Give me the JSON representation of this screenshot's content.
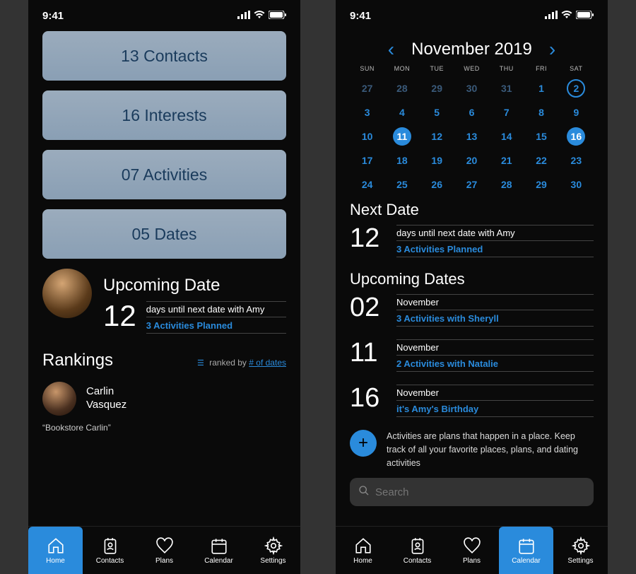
{
  "status": {
    "time": "9:41"
  },
  "home": {
    "cards": {
      "contacts": "13 Contacts",
      "interests": "16 Interests",
      "activities": "07 Activities",
      "dates": "05 Dates"
    },
    "upcoming": {
      "title": "Upcoming Date",
      "days": "12",
      "line1": "days until next date with Amy",
      "line2": "3 Activities Planned"
    },
    "rankings": {
      "title": "Rankings",
      "by_label": "ranked by",
      "by_metric": "# of dates",
      "person_first": "Carlin",
      "person_last": "Vasquez",
      "quote": "“Bookstore Carlin”"
    }
  },
  "calendar": {
    "month": "November 2019",
    "dow": [
      "SUN",
      "MON",
      "TUE",
      "WED",
      "THU",
      "FRI",
      "SAT"
    ],
    "days": [
      {
        "n": "27",
        "dim": true
      },
      {
        "n": "28",
        "dim": true
      },
      {
        "n": "29",
        "dim": true
      },
      {
        "n": "30",
        "dim": true
      },
      {
        "n": "31",
        "dim": true
      },
      {
        "n": "1"
      },
      {
        "n": "2",
        "ring": true
      },
      {
        "n": "3"
      },
      {
        "n": "4"
      },
      {
        "n": "5"
      },
      {
        "n": "6"
      },
      {
        "n": "7"
      },
      {
        "n": "8"
      },
      {
        "n": "9"
      },
      {
        "n": "10"
      },
      {
        "n": "11",
        "fill": true
      },
      {
        "n": "12"
      },
      {
        "n": "13"
      },
      {
        "n": "14"
      },
      {
        "n": "15"
      },
      {
        "n": "16",
        "fill": true
      },
      {
        "n": "17"
      },
      {
        "n": "18"
      },
      {
        "n": "19"
      },
      {
        "n": "20"
      },
      {
        "n": "21"
      },
      {
        "n": "22"
      },
      {
        "n": "23"
      },
      {
        "n": "24"
      },
      {
        "n": "25"
      },
      {
        "n": "26"
      },
      {
        "n": "27"
      },
      {
        "n": "28"
      },
      {
        "n": "29"
      },
      {
        "n": "30"
      }
    ],
    "next": {
      "title": "Next Date",
      "days": "12",
      "line1": "days until next date with Amy",
      "line2": "3 Activities Planned"
    },
    "upcoming_title": "Upcoming Dates",
    "items": [
      {
        "num": "02",
        "line1": "November",
        "line2": "3 Activities with Sheryll"
      },
      {
        "num": "11",
        "line1": "November",
        "line2": "2 Activities with Natalie"
      },
      {
        "num": "16",
        "line1": "November",
        "line2": "it's Amy's Birthday"
      }
    ],
    "hint": "Activities are plans that happen in a place. Keep track of all your favorite places, plans, and dating activities",
    "search_placeholder": "Search"
  },
  "tabs": {
    "home": "Home",
    "contacts": "Contacts",
    "plans": "Plans",
    "calendar": "Calendar",
    "settings": "Settings"
  }
}
